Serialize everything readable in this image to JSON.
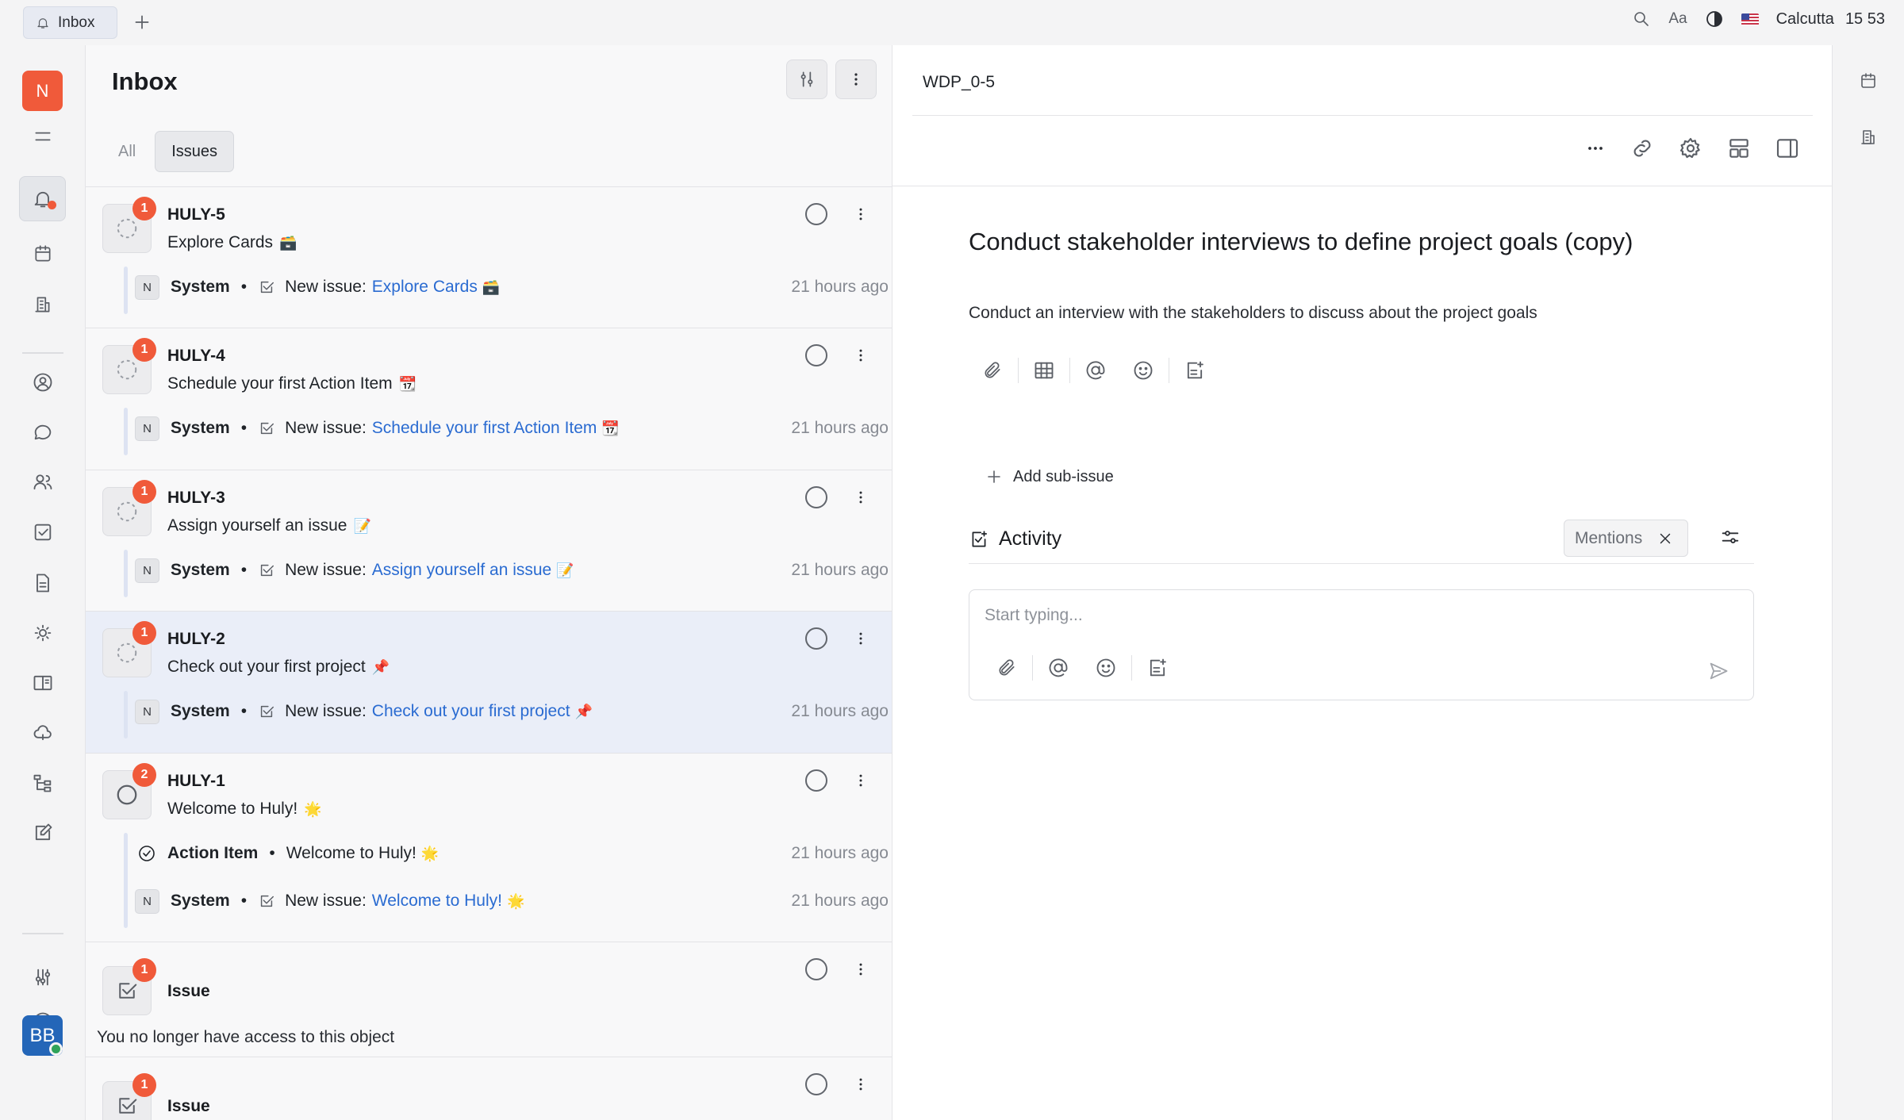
{
  "tab": {
    "label": "Inbox"
  },
  "topbar": {
    "font_label": "Aa",
    "city": "Calcutta",
    "time_h": "15",
    "time_m": "53"
  },
  "rail": {
    "workspace_initial": "N",
    "avatar_initials": "BB"
  },
  "inbox": {
    "title": "Inbox",
    "filters": [
      "All",
      "Issues"
    ],
    "no_access_text": "You no longer have access to this object",
    "items": [
      {
        "id": "HULY-5",
        "count": "1",
        "subtitle": "Explore Cards",
        "emoji": "🗃️",
        "notes": [
          {
            "initial": "N",
            "actor": "System",
            "prefix": "New issue:",
            "link": "Explore Cards",
            "emoji": "🗃️",
            "time": "21 hours ago"
          }
        ]
      },
      {
        "id": "HULY-4",
        "count": "1",
        "subtitle": "Schedule your first Action Item",
        "emoji": "📆",
        "notes": [
          {
            "initial": "N",
            "actor": "System",
            "prefix": "New issue:",
            "link": "Schedule your first Action Item",
            "emoji": "📆",
            "time": "21 hours ago"
          }
        ]
      },
      {
        "id": "HULY-3",
        "count": "1",
        "subtitle": "Assign yourself an issue",
        "emoji": "📝",
        "notes": [
          {
            "initial": "N",
            "actor": "System",
            "prefix": "New issue:",
            "link": "Assign yourself an issue",
            "emoji": "📝",
            "time": "21 hours ago"
          }
        ]
      },
      {
        "id": "HULY-2",
        "count": "1",
        "subtitle": "Check out your first project",
        "emoji": "📌",
        "notes": [
          {
            "initial": "N",
            "actor": "System",
            "prefix": "New issue:",
            "link": "Check out your first project",
            "emoji": "📌",
            "time": "21 hours ago"
          }
        ]
      },
      {
        "id": "HULY-1",
        "count": "2",
        "subtitle": "Welcome to Huly!",
        "emoji": "🌟",
        "action_note": {
          "actor": "Action Item",
          "text": "Welcome to Huly!",
          "emoji": "🌟",
          "time": "21 hours ago"
        },
        "notes": [
          {
            "initial": "N",
            "actor": "System",
            "prefix": "New issue:",
            "link": "Welcome to Huly!",
            "emoji": "🌟",
            "time": "21 hours ago"
          }
        ]
      },
      {
        "id": "Issue",
        "count": "1"
      },
      {
        "id": "Issue",
        "count": "1"
      }
    ]
  },
  "issue": {
    "breadcrumb": "WDP_0-5",
    "title": "Conduct stakeholder interviews to define project goals (copy)",
    "description": "Conduct an interview with the stakeholders to discuss about the project goals",
    "add_sub_issue": "Add sub-issue",
    "activity_label": "Activity",
    "mentions_label": "Mentions",
    "composer_placeholder": "Start typing..."
  },
  "colors": {
    "accent": "#2a6bd1",
    "badge": "#f05a3a",
    "selected_row": "#eaeef8"
  }
}
